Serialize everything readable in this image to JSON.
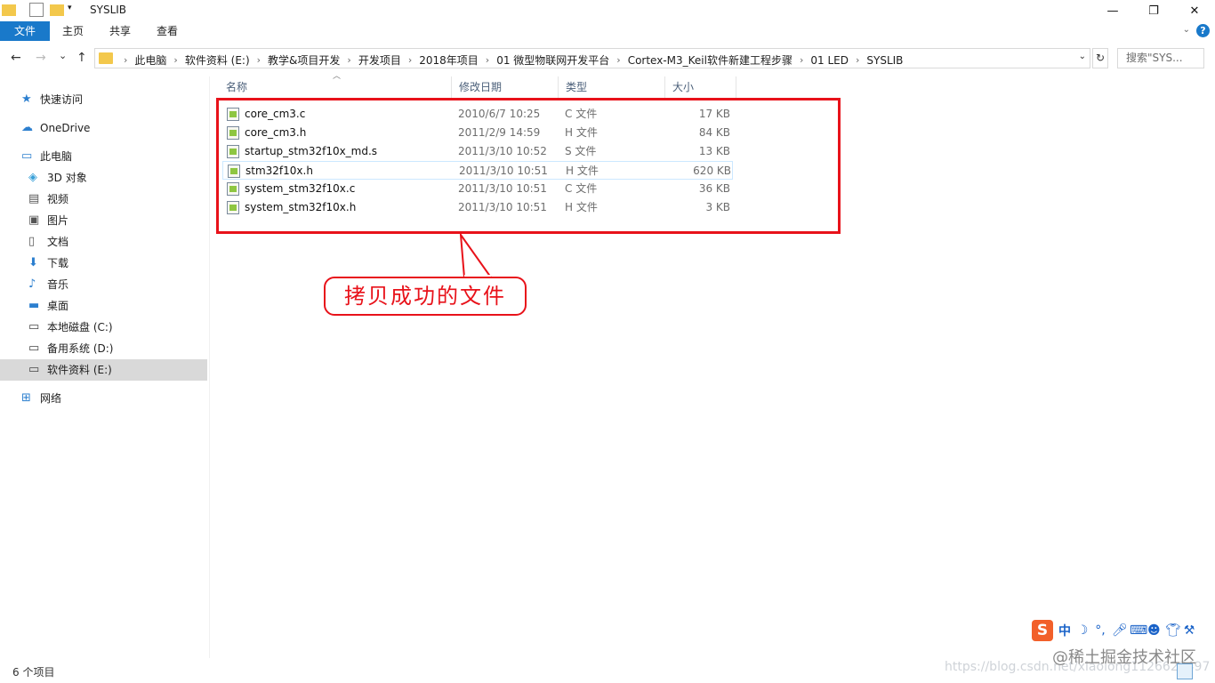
{
  "window": {
    "title": "SYSLIB",
    "minimize_glyph": "—",
    "maximize_glyph": "❐",
    "close_glyph": "✕"
  },
  "ribbon": {
    "tabs": [
      "文件",
      "主页",
      "共享",
      "查看"
    ],
    "help_label": "?"
  },
  "nav": {
    "back_glyph": "←",
    "forward_glyph": "→",
    "recent_glyph": "⌄",
    "up_glyph": "↑",
    "breadcrumbs": [
      "此电脑",
      "软件资料 (E:)",
      "教学&项目开发",
      "开发项目",
      "2018年项目",
      "01 微型物联网开发平台",
      "Cortex-M3_Keil软件新建工程步骤",
      "01 LED",
      "SYSLIB"
    ],
    "search_placeholder": "搜索\"SYS...",
    "refresh_glyph": "↻"
  },
  "sidebar": {
    "items": [
      {
        "label": "快速访问",
        "icon": "star-icon"
      },
      {
        "label": "OneDrive",
        "icon": "cloud-icon"
      },
      {
        "label": "此电脑",
        "icon": "computer-icon"
      },
      {
        "label": "3D 对象",
        "icon": "cube-icon"
      },
      {
        "label": "视频",
        "icon": "video-icon"
      },
      {
        "label": "图片",
        "icon": "picture-icon"
      },
      {
        "label": "文档",
        "icon": "document-icon"
      },
      {
        "label": "下载",
        "icon": "download-icon"
      },
      {
        "label": "音乐",
        "icon": "music-icon"
      },
      {
        "label": "桌面",
        "icon": "desktop-icon"
      },
      {
        "label": "本地磁盘 (C:)",
        "icon": "drive-icon"
      },
      {
        "label": "备用系统 (D:)",
        "icon": "drive-icon"
      },
      {
        "label": "软件资料 (E:)",
        "icon": "drive-icon",
        "selected": true
      },
      {
        "label": "网络",
        "icon": "network-icon"
      }
    ]
  },
  "columns": {
    "name": "名称",
    "modified": "修改日期",
    "type": "类型",
    "size": "大小"
  },
  "files": [
    {
      "name": "core_cm3.c",
      "modified": "2010/6/7 10:25",
      "type": "C 文件",
      "size": "17 KB"
    },
    {
      "name": "core_cm3.h",
      "modified": "2011/2/9 14:59",
      "type": "H 文件",
      "size": "84 KB"
    },
    {
      "name": "startup_stm32f10x_md.s",
      "modified": "2011/3/10 10:52",
      "type": "S 文件",
      "size": "13 KB"
    },
    {
      "name": "stm32f10x.h",
      "modified": "2011/3/10 10:51",
      "type": "H 文件",
      "size": "620 KB",
      "highlighted": true
    },
    {
      "name": "system_stm32f10x.c",
      "modified": "2011/3/10 10:51",
      "type": "C 文件",
      "size": "36 KB"
    },
    {
      "name": "system_stm32f10x.h",
      "modified": "2011/3/10 10:51",
      "type": "H 文件",
      "size": "3 KB"
    }
  ],
  "annotation": {
    "callout_text": "拷贝成功的文件",
    "color": "#e8121a"
  },
  "status": {
    "item_count": "6 个项目"
  },
  "watermark": {
    "url": "https://blog.csdn.net/xiaolong1126626497",
    "site": "@稀土掘金技术社区"
  },
  "ime": {
    "logo": "S",
    "mode": "中"
  },
  "colors": {
    "accent": "#1979ca",
    "selection": "#d9d9d9",
    "hover_border": "#cce8ff"
  }
}
